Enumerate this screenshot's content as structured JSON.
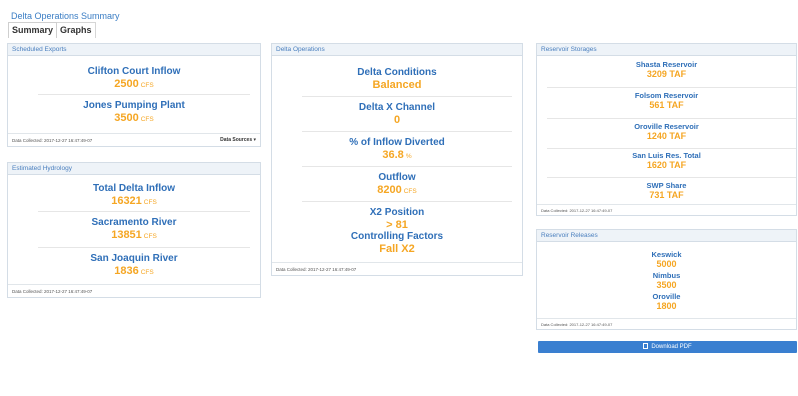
{
  "page": {
    "title": "Delta Operations Summary"
  },
  "tabs": [
    {
      "label": "Summary"
    },
    {
      "label": "Graphs"
    }
  ],
  "scheduled_exports": {
    "title": "Scheduled Exports",
    "metrics": [
      {
        "label": "Clifton Court Inflow",
        "value": "2500",
        "unit": "CFS"
      },
      {
        "label": "Jones Pumping Plant",
        "value": "3500",
        "unit": "CFS"
      }
    ],
    "footer": "Data Collected: 2017-12-27 16:47:49-07",
    "sources_label": "Data Sources ▾"
  },
  "estimated_hydrology": {
    "title": "Estimated Hydrology",
    "metrics": [
      {
        "label": "Total Delta Inflow",
        "value": "16321",
        "unit": "CFS"
      },
      {
        "label": "Sacramento River",
        "value": "13851",
        "unit": "CFS"
      },
      {
        "label": "San Joaquin River",
        "value": "1836",
        "unit": "CFS"
      }
    ],
    "footer": "Data Collected: 2017-12-27 16:47:49-07"
  },
  "delta_operations": {
    "title": "Delta Operations",
    "metrics": [
      {
        "label": "Delta Conditions",
        "value": "Balanced",
        "unit": ""
      },
      {
        "label": "Delta X Channel",
        "value": "0",
        "unit": ""
      },
      {
        "label": "% of Inflow Diverted",
        "value": "36.8",
        "unit": "%"
      },
      {
        "label": "Outflow",
        "value": "8200",
        "unit": "CFS"
      },
      {
        "label": "X2 Position",
        "value": "> 81",
        "unit": ""
      },
      {
        "label": "Controlling Factors",
        "value": "Fall X2",
        "unit": ""
      }
    ],
    "footer": "Data Collected: 2017-12-27 16:47:49-07"
  },
  "reservoir_storages": {
    "title": "Reservoir Storages",
    "metrics": [
      {
        "label": "Shasta Reservoir",
        "value": "3209 TAF"
      },
      {
        "label": "Folsom Reservoir",
        "value": "561 TAF"
      },
      {
        "label": "Oroville Reservoir",
        "value": "1240 TAF"
      },
      {
        "label": "San Luis Res. Total",
        "value": "1620 TAF"
      },
      {
        "label": "SWP Share",
        "value": "731 TAF"
      }
    ],
    "footer": "Data Collected: 2017-12-27 16:47:49-07"
  },
  "reservoir_releases": {
    "title": "Reservoir Releases",
    "metrics": [
      {
        "label": "Keswick",
        "value": "5000"
      },
      {
        "label": "Nimbus",
        "value": "3500"
      },
      {
        "label": "Oroville",
        "value": "1800"
      }
    ],
    "footer": "Data Collected: 2017-12-27 16:47:49-07"
  },
  "download": {
    "label": "Download PDF"
  }
}
